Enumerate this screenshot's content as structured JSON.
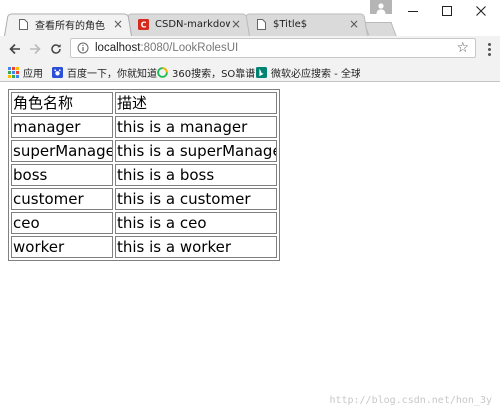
{
  "browser": {
    "tabs": [
      {
        "title": "查看所有的角色",
        "active": true,
        "favicon": "page-icon"
      },
      {
        "title": "CSDN-markdow",
        "active": false,
        "favicon": "csdn-icon"
      },
      {
        "title": "$Title$",
        "active": false,
        "favicon": "page-icon"
      }
    ],
    "close_glyph": "×",
    "url_host": "localhost",
    "url_path": ":8080/LookRolesUI",
    "bookmarks": [
      {
        "label": "应用",
        "icon": "apps-grid-icon"
      },
      {
        "label": "百度一下，你就知道",
        "icon": "baidu-icon"
      },
      {
        "label": "360搜索，SO靠谱",
        "icon": "so360-icon"
      },
      {
        "label": "微软必应搜索 - 全球",
        "icon": "bing-icon"
      }
    ]
  },
  "table": {
    "headers": [
      "角色名称",
      "描述"
    ],
    "rows": [
      [
        "manager",
        "this is a manager"
      ],
      [
        "superManager",
        "this is a superManager"
      ],
      [
        "boss",
        "this is a boss"
      ],
      [
        "customer",
        "this is a customer"
      ],
      [
        "ceo",
        "this is a ceo"
      ],
      [
        "worker",
        "this is a worker"
      ]
    ]
  },
  "watermark": "http://blog.csdn.net/hon_3y",
  "colors": {
    "csdn": "#d52b1e",
    "accent": "#1a73e8"
  }
}
